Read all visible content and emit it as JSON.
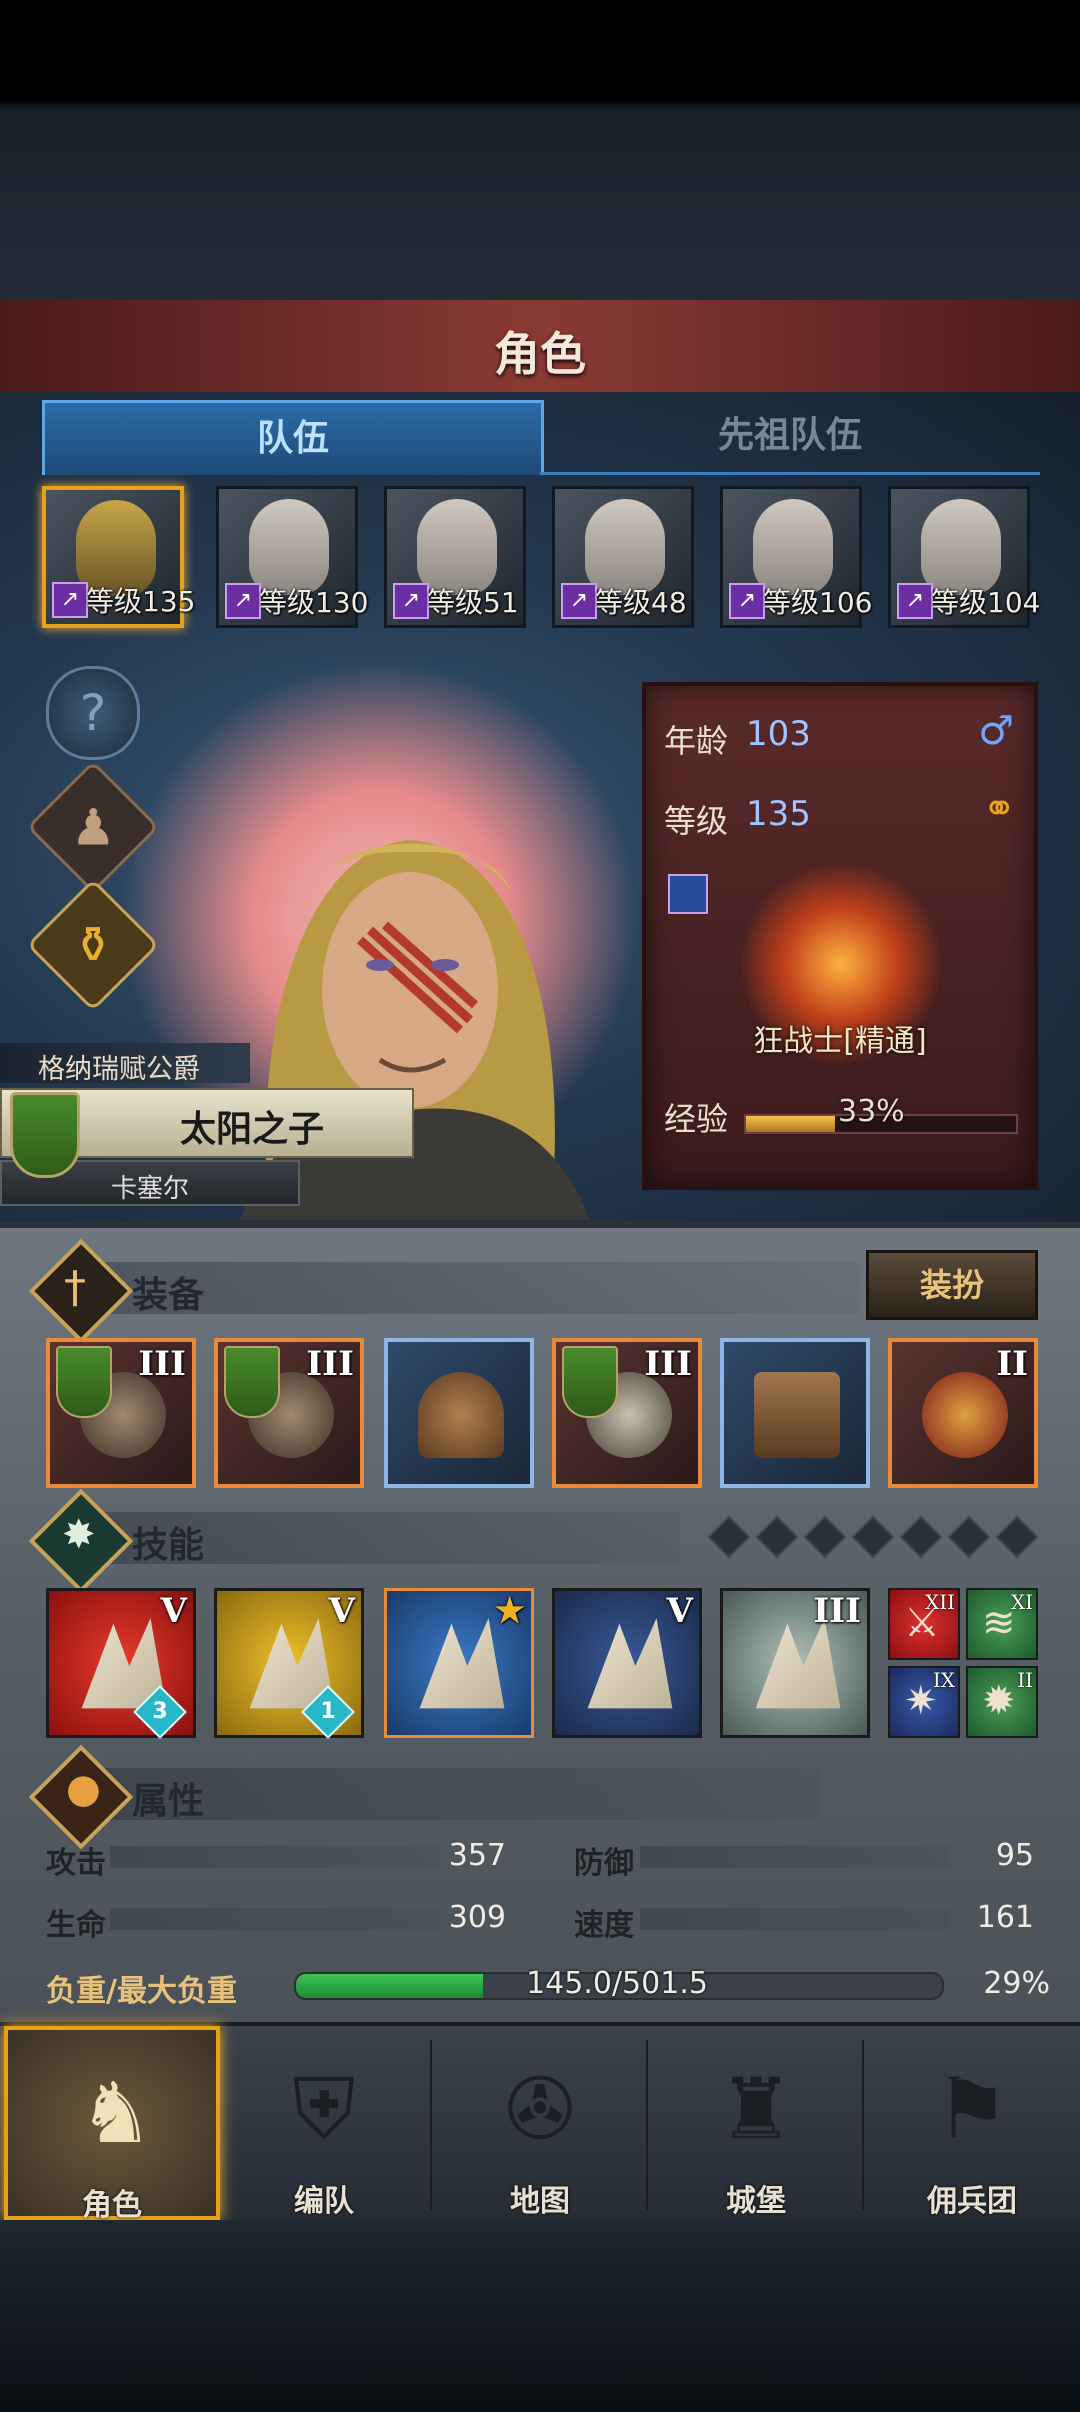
{
  "header": {
    "title": "角色"
  },
  "tabs": [
    {
      "label": "队伍"
    },
    {
      "label": "先祖队伍"
    }
  ],
  "roster": [
    {
      "level_prefix": "等级",
      "level": "135",
      "selected": true
    },
    {
      "level_prefix": "等级",
      "level": "130"
    },
    {
      "level_prefix": "等级",
      "level": "51"
    },
    {
      "level_prefix": "等级",
      "level": "48"
    },
    {
      "level_prefix": "等级",
      "level": "106"
    },
    {
      "level_prefix": "等级",
      "level": "104"
    }
  ],
  "side_buttons": [
    {
      "icon": "question-icon",
      "glyph": "?"
    },
    {
      "icon": "hood-icon",
      "glyph": "♟"
    },
    {
      "icon": "potion-icon",
      "glyph": "⚱"
    }
  ],
  "hero": {
    "noble_title": "格纳瑞赋公爵",
    "epithet": "太阳之子",
    "name": "卡塞尔"
  },
  "info": {
    "age_label": "年龄",
    "age": "103",
    "gender_glyph": "♂",
    "level_label": "等级",
    "level": "135",
    "ring_glyph": "⚭",
    "class_name": "狂战士[精通]",
    "xp_label": "经验",
    "xp_percent_text": "33%",
    "xp_fraction": 0.33
  },
  "equipment": {
    "title": "装备",
    "outfit_button": "装扮",
    "slots": [
      {
        "tier": "III",
        "icon": "spiked-pauldron-icon",
        "rarity_color": "#e88a3a"
      },
      {
        "tier": "III",
        "icon": "spiked-pauldron-icon",
        "rarity_color": "#e88a3a"
      },
      {
        "tier": "",
        "icon": "helmet-icon",
        "rarity_color": "#8fb4e8"
      },
      {
        "tier": "III",
        "icon": "fur-armor-icon",
        "rarity_color": "#e88a3a"
      },
      {
        "tier": "",
        "icon": "greaves-icon",
        "rarity_color": "#8fb4e8"
      },
      {
        "tier": "II",
        "icon": "bat-amulet-icon",
        "rarity_color": "#e88a3a"
      }
    ]
  },
  "skills": {
    "title": "技能",
    "list": [
      {
        "tier": "V",
        "count": "3",
        "color": "#c8201a",
        "icon": "sword-slash-icon"
      },
      {
        "tier": "V",
        "count": "1",
        "color": "#d4a417",
        "icon": "sword-claw-icon"
      },
      {
        "tier": "★",
        "count": "",
        "color": "#2a5a9a",
        "icon": "claw-icon"
      },
      {
        "tier": "V",
        "count": "",
        "color": "#2a4a7a",
        "icon": "crystal-sword-icon"
      },
      {
        "tier": "III",
        "count": "",
        "color": "#7a8a8a",
        "icon": "crystal-fist-icon"
      }
    ],
    "mini": [
      {
        "tier": "XII",
        "color": "#b01c1c",
        "icon": "dagger-icon"
      },
      {
        "tier": "XI",
        "color": "#3a8a4a",
        "icon": "wind-icon"
      },
      {
        "tier": "IX",
        "color": "#2a4a8a",
        "icon": "burst-icon"
      },
      {
        "tier": "II",
        "color": "#3a8a4a",
        "icon": "star-burst-icon"
      }
    ]
  },
  "attributes": {
    "title": "属性",
    "attack_label": "攻击",
    "attack": "357",
    "defense_label": "防御",
    "defense": "95",
    "hp_label": "生命",
    "hp": "309",
    "speed_label": "速度",
    "speed": "161",
    "load_label": "负重/最大负重",
    "load_text": "145.0/501.5",
    "load_percent": "29%",
    "load_fraction": 0.29
  },
  "nav": [
    {
      "label": "角色",
      "icon": "knight-icon",
      "glyph": "♞",
      "selected": true
    },
    {
      "label": "编队",
      "icon": "formation-icon",
      "glyph": "⛨"
    },
    {
      "label": "地图",
      "icon": "compass-map-icon",
      "glyph": "✇"
    },
    {
      "label": "城堡",
      "icon": "castle-icon",
      "glyph": "♜"
    },
    {
      "label": "佣兵团",
      "icon": "banner-icon",
      "glyph": "⚑"
    }
  ],
  "colors": {
    "accent": "#e8a21a",
    "tab_active": "#2e6ba8",
    "xp": "#f7c24a",
    "load": "#3fc457"
  }
}
